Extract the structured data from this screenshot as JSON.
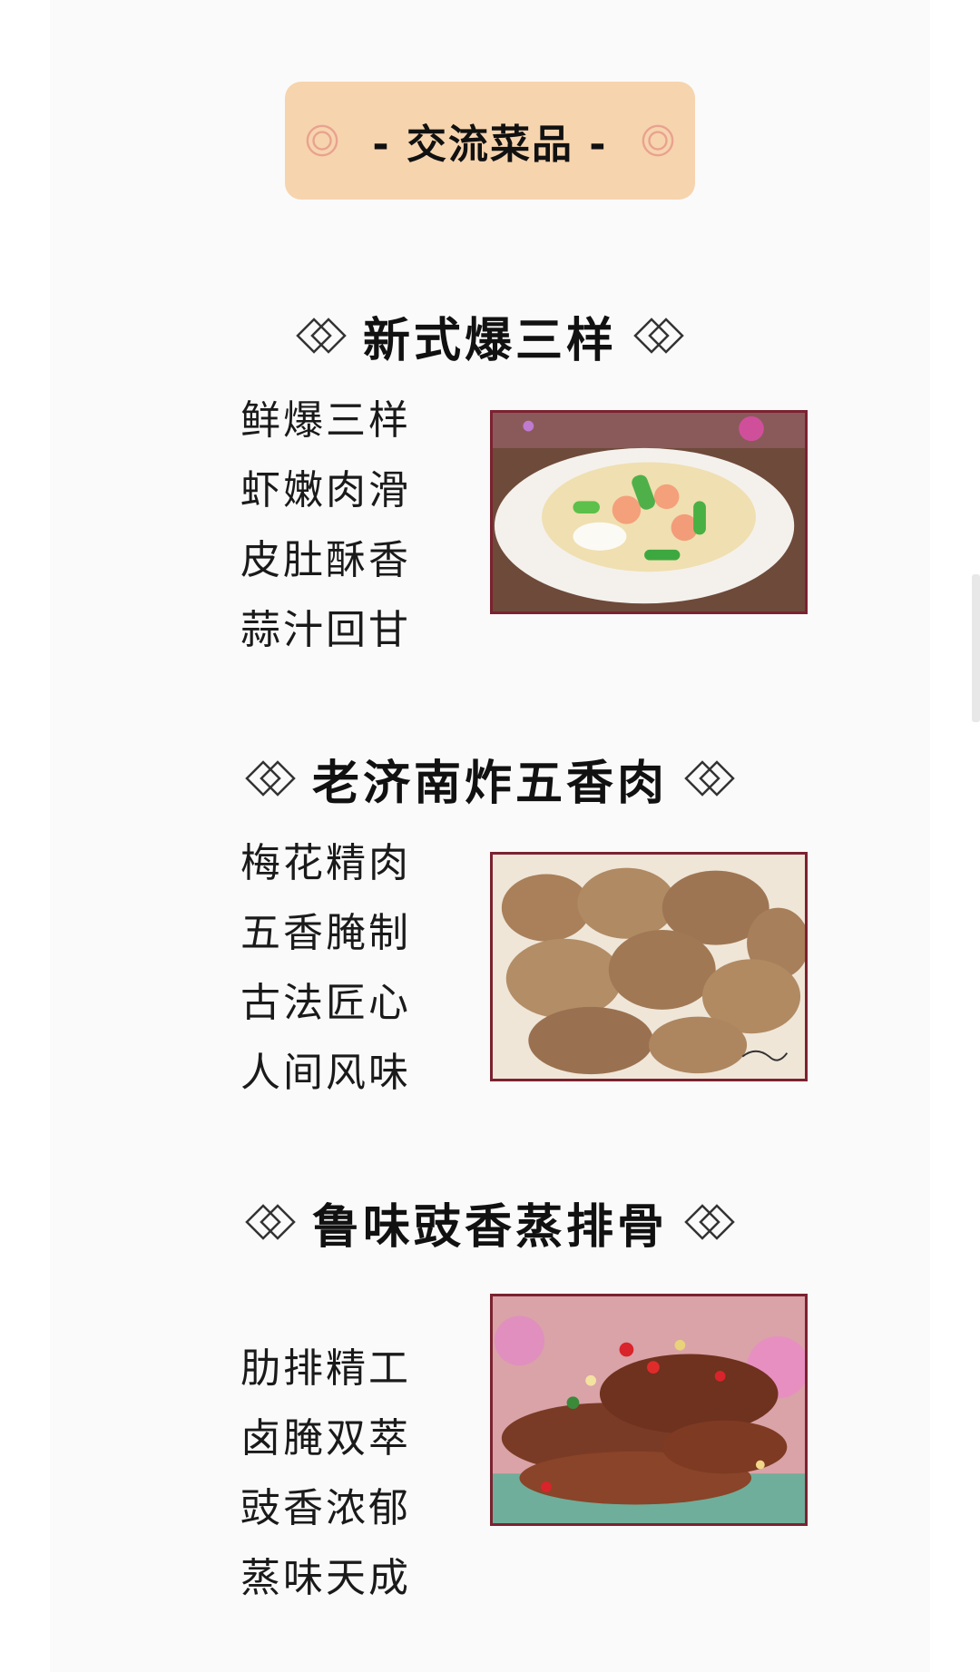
{
  "banner": {
    "title": "- 交流菜品 -",
    "icon": "target-circle-icon"
  },
  "dishes": [
    {
      "name": "新式爆三样",
      "lines": [
        "鲜爆三样",
        "虾嫩肉滑",
        "皮肚酥香",
        "蒜汁回甘"
      ],
      "photo": "stir-fried-shrimp-dish"
    },
    {
      "name": "老济南炸五香肉",
      "lines": [
        "梅花精肉",
        "五香腌制",
        "古法匠心",
        "人间风味"
      ],
      "photo": "fried-pork-dish"
    },
    {
      "name": "鲁味豉香蒸排骨",
      "lines": [
        "肋排精工",
        "卤腌双萃",
        "豉香浓郁",
        "蒸味天成"
      ],
      "photo": "steamed-ribs-dish"
    }
  ],
  "colors": {
    "banner_bg": "#f6d4ae",
    "banner_icon": "#e9a290",
    "frame": "#7b2230",
    "heading_icon": "#333333"
  }
}
